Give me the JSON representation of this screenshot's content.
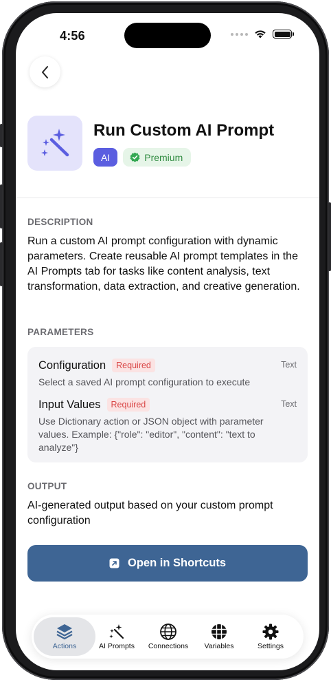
{
  "status_bar": {
    "time": "4:56"
  },
  "action": {
    "title": "Run Custom AI Prompt",
    "badges": {
      "category": "AI",
      "tier": "Premium"
    }
  },
  "description": {
    "label": "DESCRIPTION",
    "text": "Run a custom AI prompt configuration with dynamic parameters. Create reusable AI prompt templates in the AI Prompts tab for tasks like content analysis, text transformation, data extraction, and creative generation."
  },
  "parameters": {
    "label": "PARAMETERS",
    "items": [
      {
        "name": "Configuration",
        "required": "Required",
        "type": "Text",
        "description": "Select a saved AI prompt configuration to execute"
      },
      {
        "name": "Input Values",
        "required": "Required",
        "type": "Text",
        "description": "Use Dictionary action or JSON object with parameter values. Example: {\"role\": \"editor\", \"content\": \"text to analyze\"}"
      }
    ]
  },
  "output": {
    "label": "OUTPUT",
    "text": "AI-generated output based on your custom prompt configuration"
  },
  "open_button": {
    "label": "Open in Shortcuts"
  },
  "tabbar": {
    "tabs": [
      {
        "label": "Actions",
        "icon": "stack-icon",
        "active": true
      },
      {
        "label": "AI Prompts",
        "icon": "magic-wand-icon",
        "active": false
      },
      {
        "label": "Connections",
        "icon": "globe-icon",
        "active": false
      },
      {
        "label": "Variables",
        "icon": "grid-globe-icon",
        "active": false
      },
      {
        "label": "Settings",
        "icon": "gear-icon",
        "active": false
      }
    ]
  },
  "colors": {
    "accent": "#3e6594",
    "ai_badge": "#5b5ee0",
    "premium_badge_bg": "#e6f5e8",
    "premium_badge_text": "#2e8a3f",
    "required_bg": "#fbe3e3",
    "required_text": "#d94646",
    "icon_tile_bg": "#e4e3fb"
  }
}
